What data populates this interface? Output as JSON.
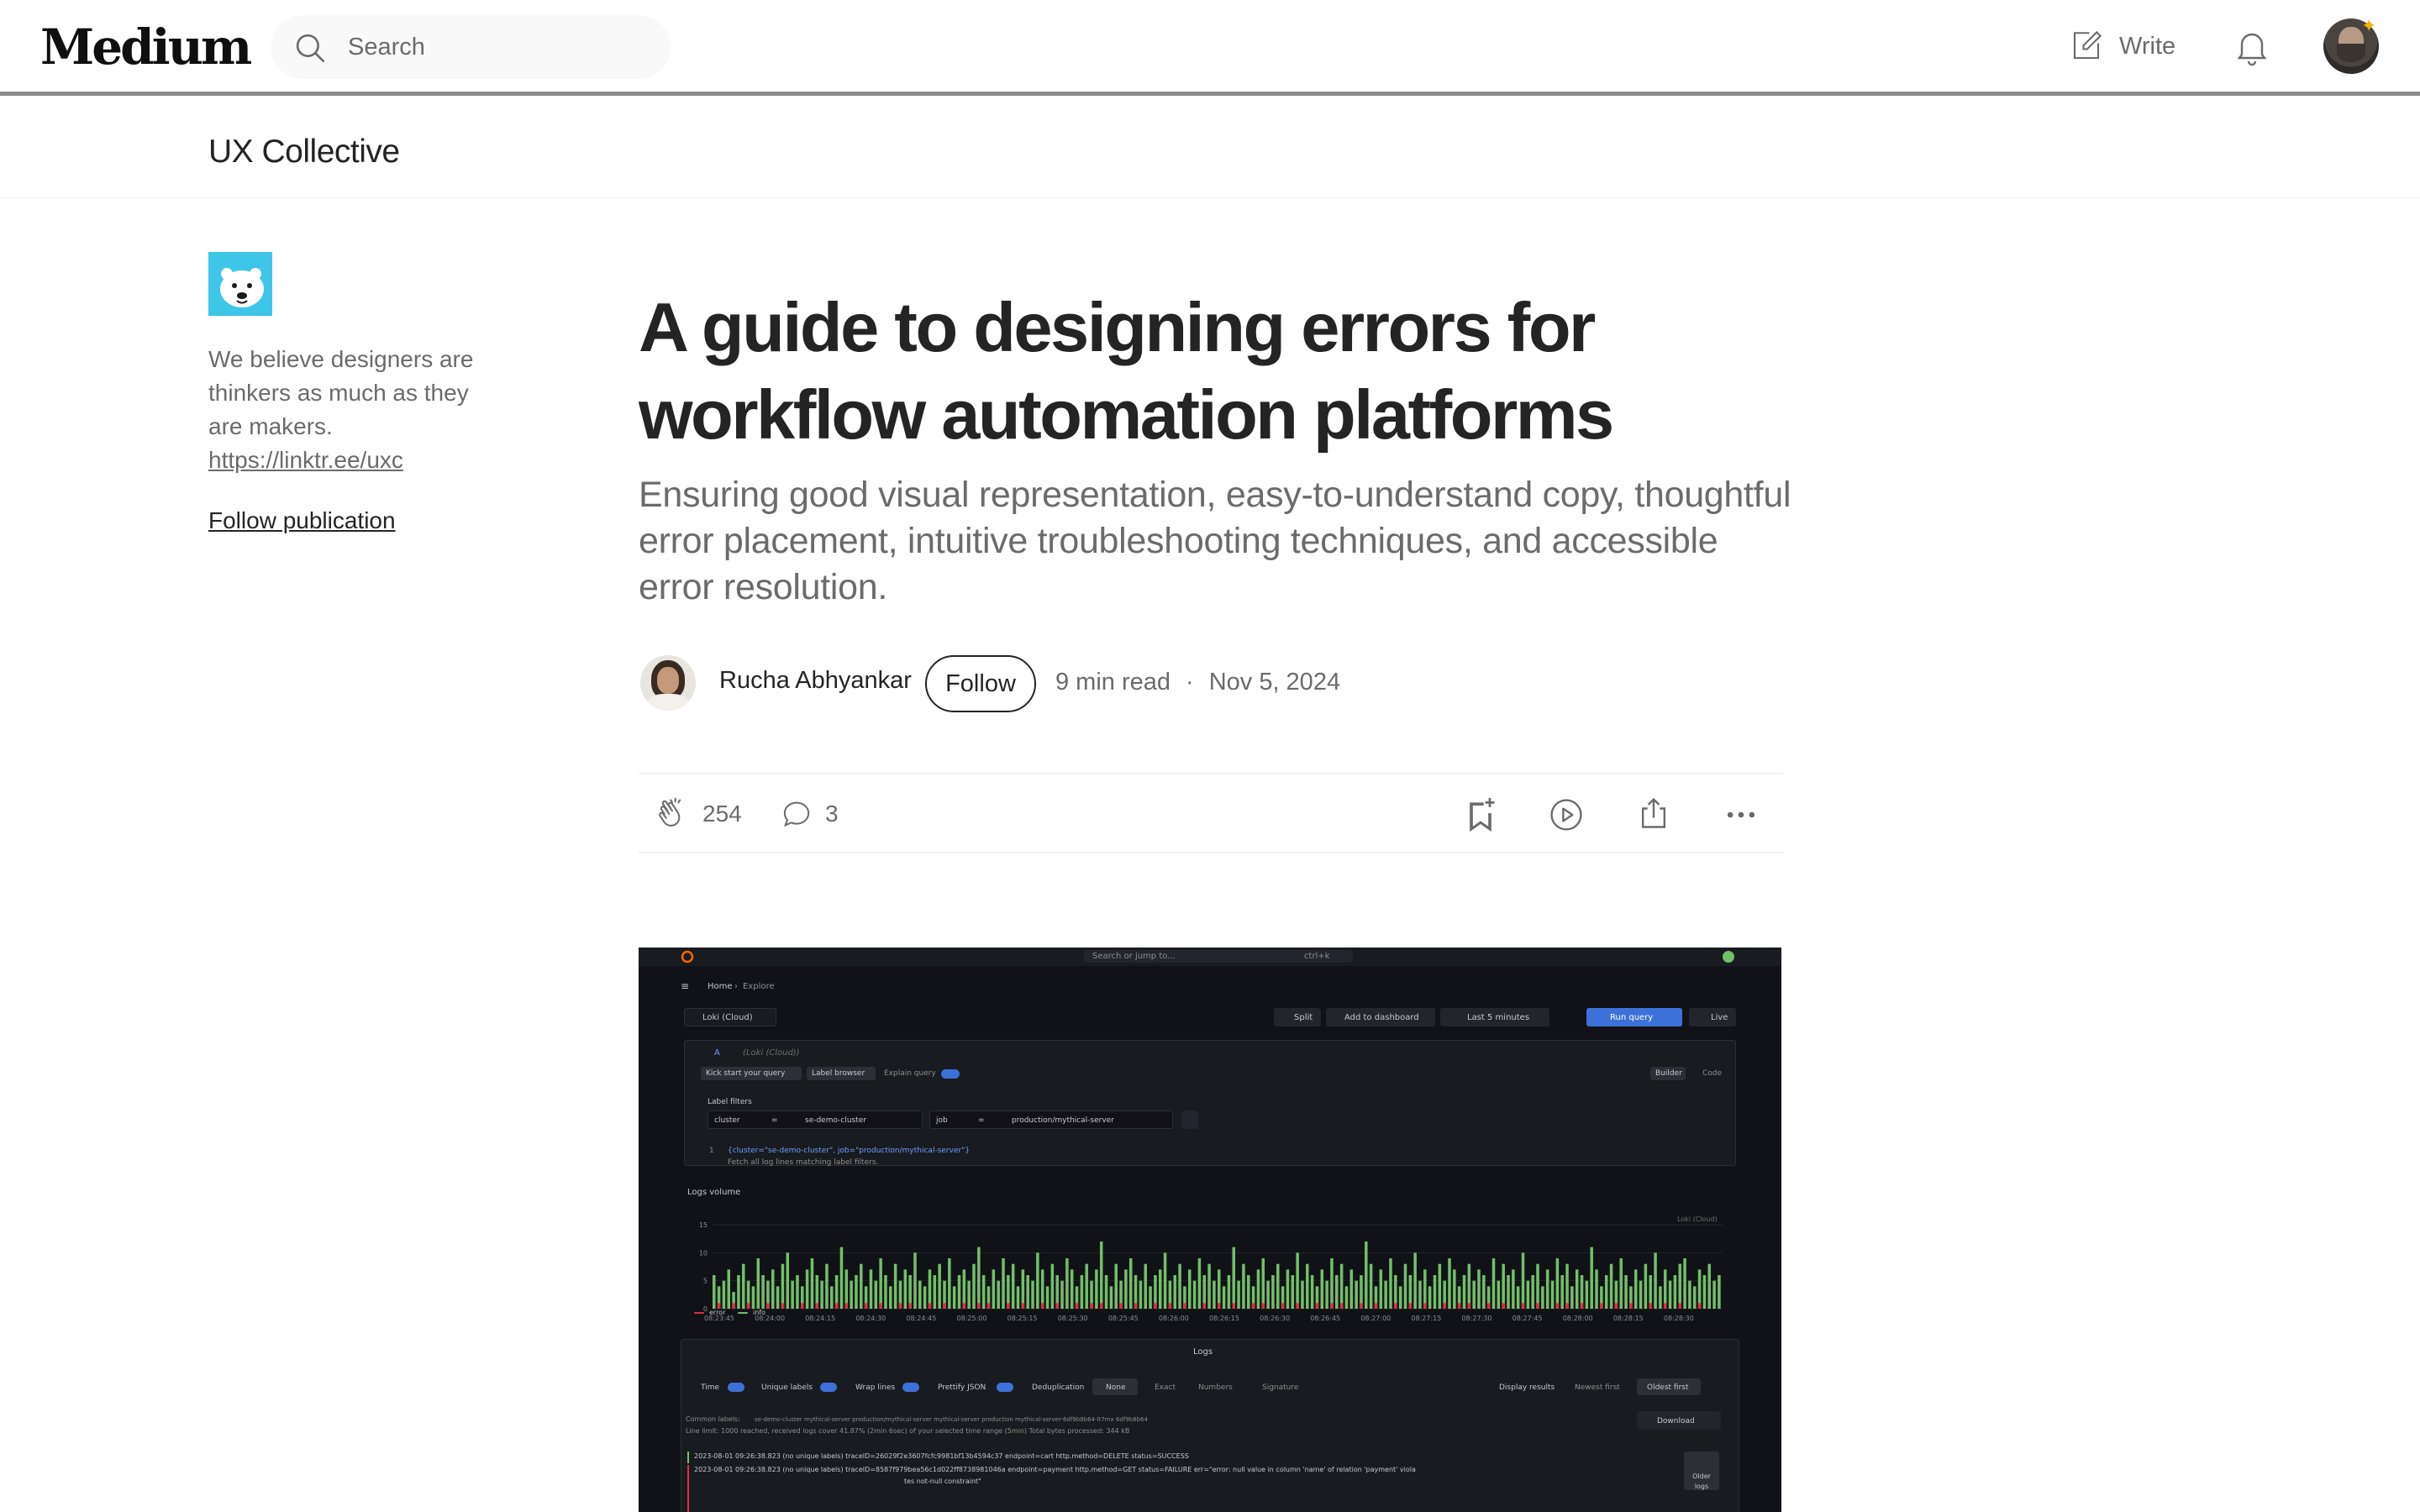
{
  "nav": {
    "logo": "Medium",
    "search_placeholder": "Search",
    "write_label": "Write"
  },
  "publication": {
    "name": "UX Collective",
    "description": "We believe designers are thinkers as much as they are makers.",
    "link": "https://linktr.ee/uxc",
    "follow_label": "Follow publication"
  },
  "article": {
    "title": "A guide to designing errors for workflow automation platforms",
    "subtitle": "Ensuring good visual representation, easy-to-understand copy, thoughtful error placement, intuitive troubleshooting techniques, and accessible error resolution.",
    "author": "Rucha Abhyankar",
    "follow_label": "Follow",
    "read_time": "9 min read",
    "separator": "·",
    "date": "Nov 5, 2024",
    "claps": "254",
    "comments": "3"
  },
  "hero": {
    "search": "Search or jump to...",
    "shortcut": "ctrl+k",
    "breadcrumb_home": "Home",
    "breadcrumb_sep": "›",
    "breadcrumb_page": "Explore",
    "datasource": "Loki (Cloud)",
    "btn_split": "Split",
    "btn_add": "Add to dashboard",
    "btn_time": "Last 5 minutes",
    "btn_run": "Run query",
    "btn_live": "Live",
    "query_letter": "A",
    "query_ds": "(Loki (Cloud))",
    "kick_start": "Kick start your query",
    "label_browser": "Label browser",
    "explain_query": "Explain query",
    "builder": "Builder",
    "code": "Code",
    "label_filters": "Label filters",
    "f1_key": "cluster",
    "f1_op": "=",
    "f1_val": "se-demo-cluster",
    "f2_key": "job",
    "f2_op": "=",
    "f2_val": "production/mythical-server",
    "query_num": "1",
    "query_text": "{cluster=\"se-demo-cluster\", job=\"production/mythical-server\"}",
    "query_hint": "Fetch all log lines matching label filters.",
    "logs_volume": "Logs volume",
    "chart_source": "Loki (Cloud)",
    "legend_error": "error",
    "legend_info": "info",
    "logs_title": "Logs",
    "opt_time": "Time",
    "opt_unique": "Unique labels",
    "opt_wrap": "Wrap lines",
    "opt_prettify": "Prettify JSON",
    "opt_dedup": "Deduplication",
    "dedup_none": "None",
    "dedup_exact": "Exact",
    "dedup_numbers": "Numbers",
    "dedup_signature": "Signature",
    "display_results": "Display results",
    "newest_first": "Newest first",
    "oldest_first": "Oldest first",
    "common_labels_key": "Common labels:",
    "common_labels_val": "se-demo-cluster  mythical-server  production/mythical-server  mythical-server  production  mythical-server-6df9b8b64-lt7mx  6df9b8b64",
    "line_limit": "Line limit: 1000 reached, received logs cover 41.87% (2min 6sec) of your selected time range (5min)   Total bytes processed: 344 kB",
    "download": "Download",
    "log1": "2023-08-01 09:26:38.823  (no unique labels)  traceID=26029f2e3607fcfc9981bf13b4594c37 endpoint=cart http.method=DELETE status=SUCCESS",
    "log2": "2023-08-01 09:26:38.823  (no unique labels)  traceID=8587f979bea56c1d022ff8738981046a endpoint=payment http.method=GET status=FAILURE err=\"error: null value in column 'name' of relation 'payment' viola",
    "log2b": "tes not-null constraint\"",
    "older_logs": "Older logs"
  },
  "chart_data": {
    "type": "bar",
    "title": "",
    "ylim": [
      0,
      15
    ],
    "yticks": [
      "15",
      "10",
      "5",
      "0"
    ],
    "xticks": [
      "08:23:45",
      "08:24:00",
      "08:24:15",
      "08:24:30",
      "08:24:45",
      "08:25:00",
      "08:25:15",
      "08:25:30",
      "08:25:45",
      "08:26:00",
      "08:26:15",
      "08:26:30",
      "08:26:45",
      "08:27:00",
      "08:27:15",
      "08:27:30",
      "08:27:45",
      "08:28:00",
      "08:28:15",
      "08:28:30"
    ],
    "series": [
      {
        "name": "error",
        "color": "#e02f44"
      },
      {
        "name": "info",
        "color": "#73bf69"
      }
    ],
    "info_values": [
      6,
      4,
      5,
      7,
      3,
      6,
      8,
      5,
      4,
      9,
      6,
      5,
      7,
      4,
      8,
      10,
      5,
      6,
      4,
      7,
      9,
      6,
      5,
      8,
      4,
      6,
      11,
      7,
      5,
      6,
      8,
      4,
      7,
      5,
      9,
      6,
      4,
      8,
      5,
      7,
      6,
      10,
      5,
      4,
      7,
      6,
      8,
      5,
      9,
      4,
      6,
      7,
      5,
      8,
      11,
      6,
      4,
      7,
      5,
      9,
      6,
      8,
      4,
      7,
      6,
      5,
      10,
      7,
      4,
      8,
      6,
      5,
      9,
      7,
      4,
      6,
      8,
      5,
      7,
      12,
      6,
      4,
      8,
      5,
      7,
      9,
      6,
      5,
      8,
      4,
      6,
      7,
      10,
      5,
      6,
      8,
      4,
      7,
      5,
      9,
      6,
      8,
      5,
      7,
      4,
      6,
      11,
      5,
      8,
      6,
      4,
      7,
      9,
      5,
      6,
      8,
      4,
      7,
      6,
      10,
      5,
      8,
      6,
      4,
      7,
      5,
      9,
      6,
      8,
      4,
      7,
      5,
      6,
      12,
      8,
      4,
      7,
      5,
      9,
      6,
      4,
      8,
      6,
      10,
      5,
      7,
      4,
      6,
      8,
      5,
      9,
      7,
      4,
      6,
      8,
      5,
      7,
      6,
      4,
      9,
      5,
      8,
      6,
      7,
      4,
      10,
      5,
      6,
      8,
      4,
      7,
      5,
      9,
      6,
      8,
      4,
      7,
      6,
      5,
      11,
      7,
      4,
      6,
      8,
      5,
      9,
      6,
      4,
      7,
      5,
      8,
      6,
      10,
      4,
      7,
      5,
      6,
      8,
      9,
      5,
      4,
      7,
      6,
      8,
      5,
      6
    ],
    "error_values": [
      0,
      1,
      0,
      0,
      1,
      0,
      0,
      1,
      0,
      0,
      0,
      1,
      0,
      0,
      1,
      0,
      0,
      0,
      1,
      0,
      0,
      1,
      0,
      0,
      0,
      1,
      0,
      1,
      0,
      0,
      0,
      1,
      0,
      0,
      1,
      0,
      0,
      0,
      1,
      0,
      1,
      0,
      0,
      0,
      1,
      0,
      0,
      1,
      0,
      0,
      0,
      1,
      0,
      0,
      1,
      0,
      1,
      0,
      0,
      0,
      1,
      0,
      0,
      1,
      0,
      0,
      0,
      1,
      0,
      0,
      1,
      0,
      0,
      0,
      1,
      0,
      0,
      1,
      0,
      1,
      0,
      0,
      0,
      1,
      0,
      0,
      1,
      0,
      0,
      0,
      1,
      0,
      0,
      1,
      0,
      0,
      1,
      0,
      0,
      0,
      1,
      0,
      0,
      1,
      0,
      0,
      1,
      0,
      0,
      0,
      1,
      0,
      1,
      0,
      0,
      0,
      1,
      0,
      0,
      1,
      0,
      0,
      0,
      1,
      0,
      0,
      1,
      0,
      1,
      0,
      0,
      0,
      1,
      0,
      0,
      1,
      0,
      0,
      0,
      1,
      0,
      0,
      1,
      0,
      0,
      1,
      0,
      0,
      0,
      1,
      0,
      0,
      1,
      0,
      1,
      0,
      0,
      0,
      1,
      0,
      0,
      1,
      0,
      0,
      0,
      1,
      0,
      0,
      1,
      0,
      0,
      0,
      1,
      0,
      1,
      0,
      0,
      1,
      0,
      0,
      0,
      1,
      0,
      0,
      1,
      0,
      0,
      1,
      0,
      0,
      0,
      1,
      0,
      0,
      1,
      0,
      0,
      1,
      0,
      0,
      0,
      1
    ]
  },
  "colors": {
    "text_primary": "#242424",
    "text_secondary": "#6b6b6b",
    "grafana_bg": "#111217",
    "grafana_panel": "#181b1f",
    "grafana_blue": "#3d71d9"
  }
}
